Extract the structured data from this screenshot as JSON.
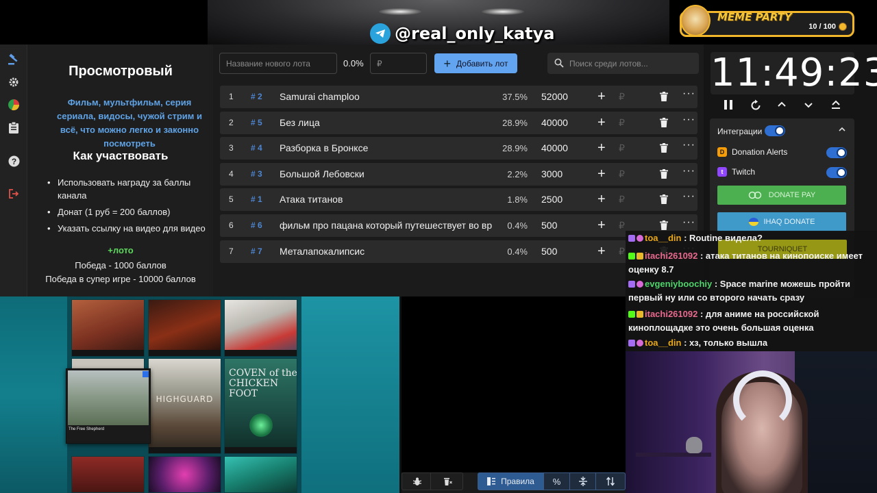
{
  "banner": {
    "handle": "@real_only_katya",
    "meme_party": {
      "title": "MEME PARTY",
      "count": "10 / 100"
    }
  },
  "nav": {
    "icons": [
      "gavel-icon",
      "gear-icon",
      "pie-chart-icon",
      "clipboard-icon",
      "help-icon",
      "logout-icon"
    ]
  },
  "rules": {
    "title": "Просмотровый",
    "description": "Фильм, мультфильм, серия сериала, видосы, чужой стрим и всё, что можно легко и законно посмотреть",
    "how_title": "Как участвовать",
    "items": [
      "Использовать награду за баллы канала",
      "Донат (1 руб = 200 баллов)",
      "Указать ссылку на видео для видео"
    ],
    "loto": "+лото",
    "win1": "Победа - 1000 баллов",
    "win2": "Победа в супер игре - 10000 баллов"
  },
  "toolbar": {
    "new_lot_placeholder": "Название нового лота",
    "percent": "0.0%",
    "amount_placeholder": "₽",
    "add_label": "Добавить лот",
    "search_placeholder": "Поиск среди лотов..."
  },
  "lots": [
    {
      "num": "1",
      "id": "# 2",
      "name": "Samurai champloo",
      "pct": "37.5%",
      "amount": "52000"
    },
    {
      "num": "2",
      "id": "# 5",
      "name": "Без лица",
      "pct": "28.9%",
      "amount": "40000"
    },
    {
      "num": "3",
      "id": "# 4",
      "name": "Разборка в Бронксе",
      "pct": "28.9%",
      "amount": "40000"
    },
    {
      "num": "4",
      "id": "# 3",
      "name": "Большой Лебовски",
      "pct": "2.2%",
      "amount": "3000"
    },
    {
      "num": "5",
      "id": "# 1",
      "name": "Атака титанов",
      "pct": "1.8%",
      "amount": "2500"
    },
    {
      "num": "6",
      "id": "# 6",
      "name": "фильм про пацана который путешествует во вр",
      "pct": "0.4%",
      "amount": "500"
    },
    {
      "num": "7",
      "id": "# 7",
      "name": "Металапокалипсис",
      "pct": "0.4%",
      "amount": "500"
    }
  ],
  "lot_row_symbols": {
    "plus": "+",
    "rub": "₽",
    "more": "···"
  },
  "timer": {
    "value": "11:49:23"
  },
  "integrations": {
    "label": "Интеграции",
    "services": [
      {
        "name": "Donation Alerts",
        "color": "#f59c07"
      },
      {
        "name": "Twitch",
        "color": "#9146ff"
      }
    ],
    "donatepay": "DONATE PAY",
    "ihaq": "IHAQ DONATE",
    "tourniquet": "TOURNIQUET"
  },
  "chat": [
    {
      "user": "toa__din",
      "text": " : Routine видела?",
      "badges": [
        "twitch",
        "heart"
      ]
    },
    {
      "user": "itachi261092",
      "text": " : атака титанов на кинопоиске имеет оценку 8.7",
      "badges": [
        "kick",
        "crown"
      ]
    },
    {
      "user": "evgeniyboochiy",
      "text": " : Space marine можешь пройти первый ну или со второго начать сразу",
      "badges": [
        "twitch",
        "heart"
      ]
    },
    {
      "user": "itachi261092",
      "text": " : для аниме на российской киноплощадке это очень большая оценка",
      "badges": [
        "kick",
        "crown"
      ]
    },
    {
      "user": "toa__din",
      "text": " : хз, только вышла",
      "badges": [
        "twitch",
        "heart"
      ]
    }
  ],
  "store": {
    "highguard": "HIGHGUARD",
    "coven": "COVEN of the CHICKEN FOOT",
    "free_shepherd": "The Free Shepherd"
  },
  "bottom": {
    "rules_label": "Правила"
  },
  "colors": {
    "accent": "#63a4f0",
    "hash": "#4d86d2",
    "loto": "#5ed75e",
    "desc": "#5fa3e6"
  }
}
